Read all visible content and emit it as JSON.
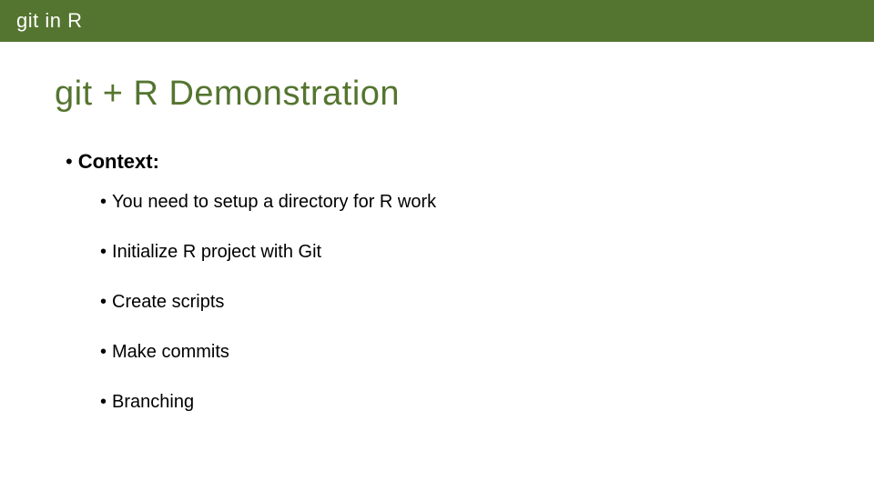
{
  "header": {
    "title": "git in R"
  },
  "slide": {
    "title": "git + R Demonstration"
  },
  "context": {
    "bullet": "•",
    "label": "Context:"
  },
  "bullets": {
    "dot": "•",
    "items": [
      "You need to setup a directory for R work",
      "Initialize R project with Git",
      "Create scripts",
      "Make commits",
      "Branching"
    ]
  }
}
